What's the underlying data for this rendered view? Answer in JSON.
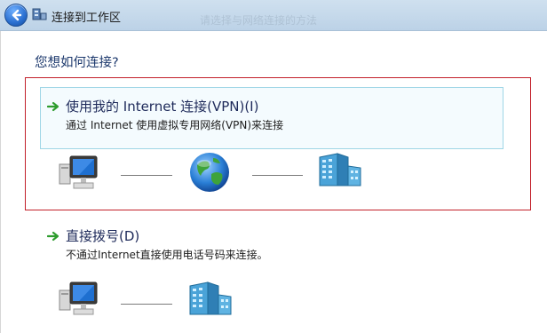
{
  "titlebar": {
    "title": "连接到工作区",
    "ghost_text": "请选择与网络连接的方法"
  },
  "main": {
    "question": "您想如何连接?",
    "options": [
      {
        "title": "使用我的 Internet 连接(VPN)(I)",
        "description": "通过 Internet 使用虚拟专用网络(VPN)来连接",
        "selected": true,
        "icons": [
          "computer-icon",
          "globe-icon",
          "server-building-icon"
        ]
      },
      {
        "title": "直接拨号(D)",
        "description": "不通过Internet直接使用电话号码来连接。",
        "selected": false,
        "icons": [
          "computer-icon",
          "server-building-icon"
        ]
      }
    ]
  },
  "colors": {
    "selection_border": "#c2202a",
    "option_highlight_bg": "#f4fbfe",
    "option_highlight_border": "#9fd6e6",
    "arrow": "#2e9c2e"
  }
}
